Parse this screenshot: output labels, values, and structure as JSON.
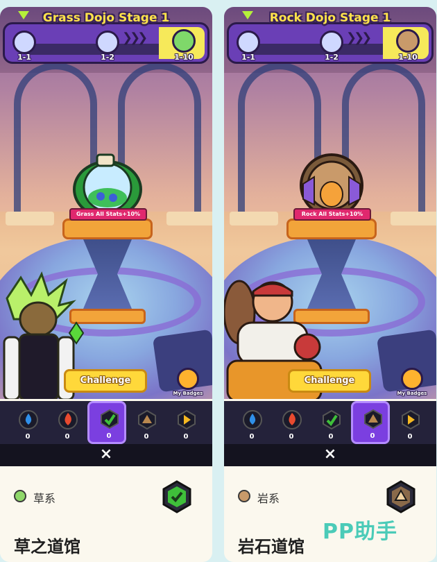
{
  "panels": [
    {
      "stage_title": "Grass Dojo Stage 1",
      "nodes": [
        "1-1",
        "1-2",
        "1-10"
      ],
      "bonus_label": "Grass All Stats+10%",
      "challenge_label": "Challenge",
      "my_badges_label": "My Badges",
      "active_tab": 2,
      "type_label": "草系",
      "gym_name": "草之道馆",
      "accent": "#3fbf3a"
    },
    {
      "stage_title": "Rock Dojo Stage 1",
      "nodes": [
        "1-1",
        "1-2",
        "1-10"
      ],
      "bonus_label": "Rock All Stats+10%",
      "challenge_label": "Challenge",
      "my_badges_label": "My Badges",
      "active_tab": 3,
      "type_label": "岩系",
      "gym_name": "岩石道馆",
      "accent": "#a9713f"
    }
  ],
  "tabs": [
    {
      "icon": "water-badge-icon",
      "count": "0",
      "color": "#2f8fe8"
    },
    {
      "icon": "fire-badge-icon",
      "count": "0",
      "color": "#e84a2f"
    },
    {
      "icon": "grass-badge-icon",
      "count": "0",
      "color": "#3fbf3a"
    },
    {
      "icon": "rock-badge-icon",
      "count": "0",
      "color": "#b9884f"
    },
    {
      "icon": "electric-badge-icon",
      "count": "0",
      "color": "#f5b821"
    }
  ],
  "close_icon": "×",
  "watermark": "PP助手"
}
